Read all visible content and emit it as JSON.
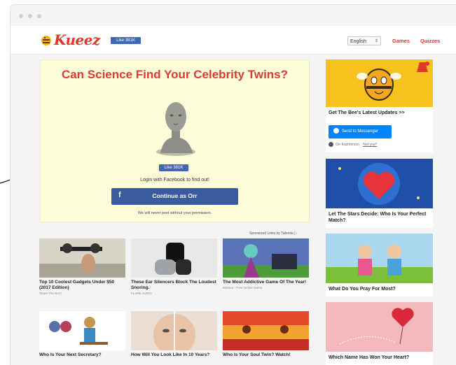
{
  "titlebar": {
    "dots": 3
  },
  "header": {
    "logo_text": "Kueez",
    "fb_like": "Like 381K",
    "language": "English",
    "nav": [
      "Games",
      "Quizzes"
    ]
  },
  "hero": {
    "title": "Can Science Find Your Celebrity Twins?",
    "fb_like": "Like 381K",
    "login_text": "Login with Facebook to find out!",
    "continue_label": "Continue as Orr",
    "continue_icon": "f",
    "note": "We will never post without your permission."
  },
  "sponsored": {
    "label": "Sponsored Links by Taboola"
  },
  "cards": [
    {
      "title": "Top 10 Coolest Gadgets Under $50 (2017 Edition)",
      "source": "Share The Buzz"
    },
    {
      "title": "These Ear Silencers Block The Loudest Snoring.",
      "source": "FLARE AUDIO"
    },
    {
      "title": "The Most Addictive Game Of The Year!",
      "source": "Elvenar - Free Online Game"
    },
    {
      "title": "Who Is Your Next Secretary?",
      "source": ""
    },
    {
      "title": "How Will You Look Like In 10 Years?",
      "source": ""
    },
    {
      "title": "Who Is Your Soul Twin? Watch!",
      "source": ""
    }
  ],
  "sidebar": [
    {
      "caption": "Get The Bee's Latest Updates >>",
      "messenger_label": "Send to Messenger",
      "user_name": "Orr Kazmerson",
      "user_link": "Not you?"
    },
    {
      "caption": "Let The Stars Decide: Who Is Your Perfect Match?"
    },
    {
      "caption": "What Do You Pray For Most?"
    },
    {
      "caption": "Which Name Has Won Your Heart?"
    }
  ],
  "colors": {
    "brand_red": "#e0362b",
    "facebook_blue": "#3b5ba0",
    "messenger_blue": "#0084ff",
    "hero_bg": "#fefdd9"
  }
}
